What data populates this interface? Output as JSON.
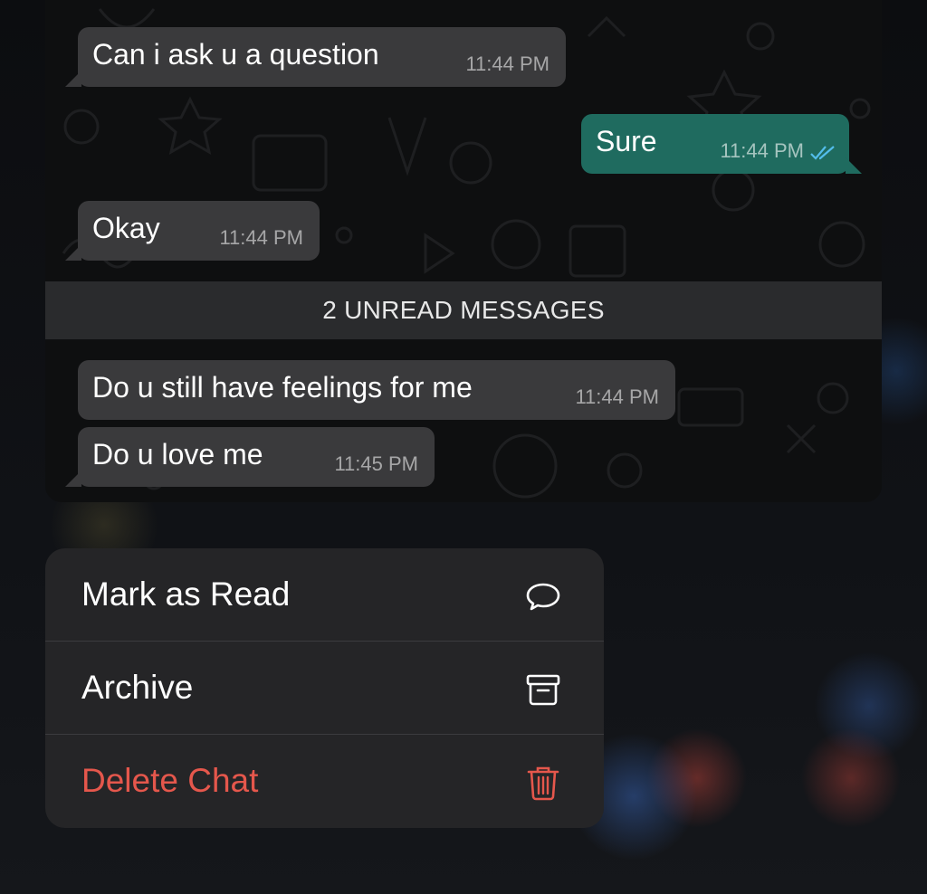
{
  "chat": {
    "messages": [
      {
        "direction": "in",
        "text": "Can i ask u a question",
        "time": "11:44 PM"
      },
      {
        "direction": "out",
        "text": "Sure",
        "time": "11:44 PM",
        "status": "read-double-check-icon"
      },
      {
        "direction": "in",
        "text": "Okay",
        "time": "11:44 PM"
      },
      {
        "direction": "in",
        "text": "Do u still have feelings for me",
        "time": "11:44 PM"
      },
      {
        "direction": "in",
        "text": "Do u love me",
        "time": "11:45 PM"
      }
    ],
    "unread_banner": "2 UNREAD MESSAGES"
  },
  "context_menu": {
    "items": [
      {
        "label": "Mark as Read",
        "icon": "chat-bubble-icon"
      },
      {
        "label": "Archive",
        "icon": "archive-box-icon"
      },
      {
        "label": "Delete Chat",
        "icon": "trash-icon",
        "destructive": true
      }
    ]
  },
  "colors": {
    "incoming_bubble": "#3a3a3c",
    "outgoing_bubble": "#1f6b5f",
    "menu_background": "#252527",
    "destructive": "#e5574c",
    "read_ticks": "#53bdeb"
  }
}
